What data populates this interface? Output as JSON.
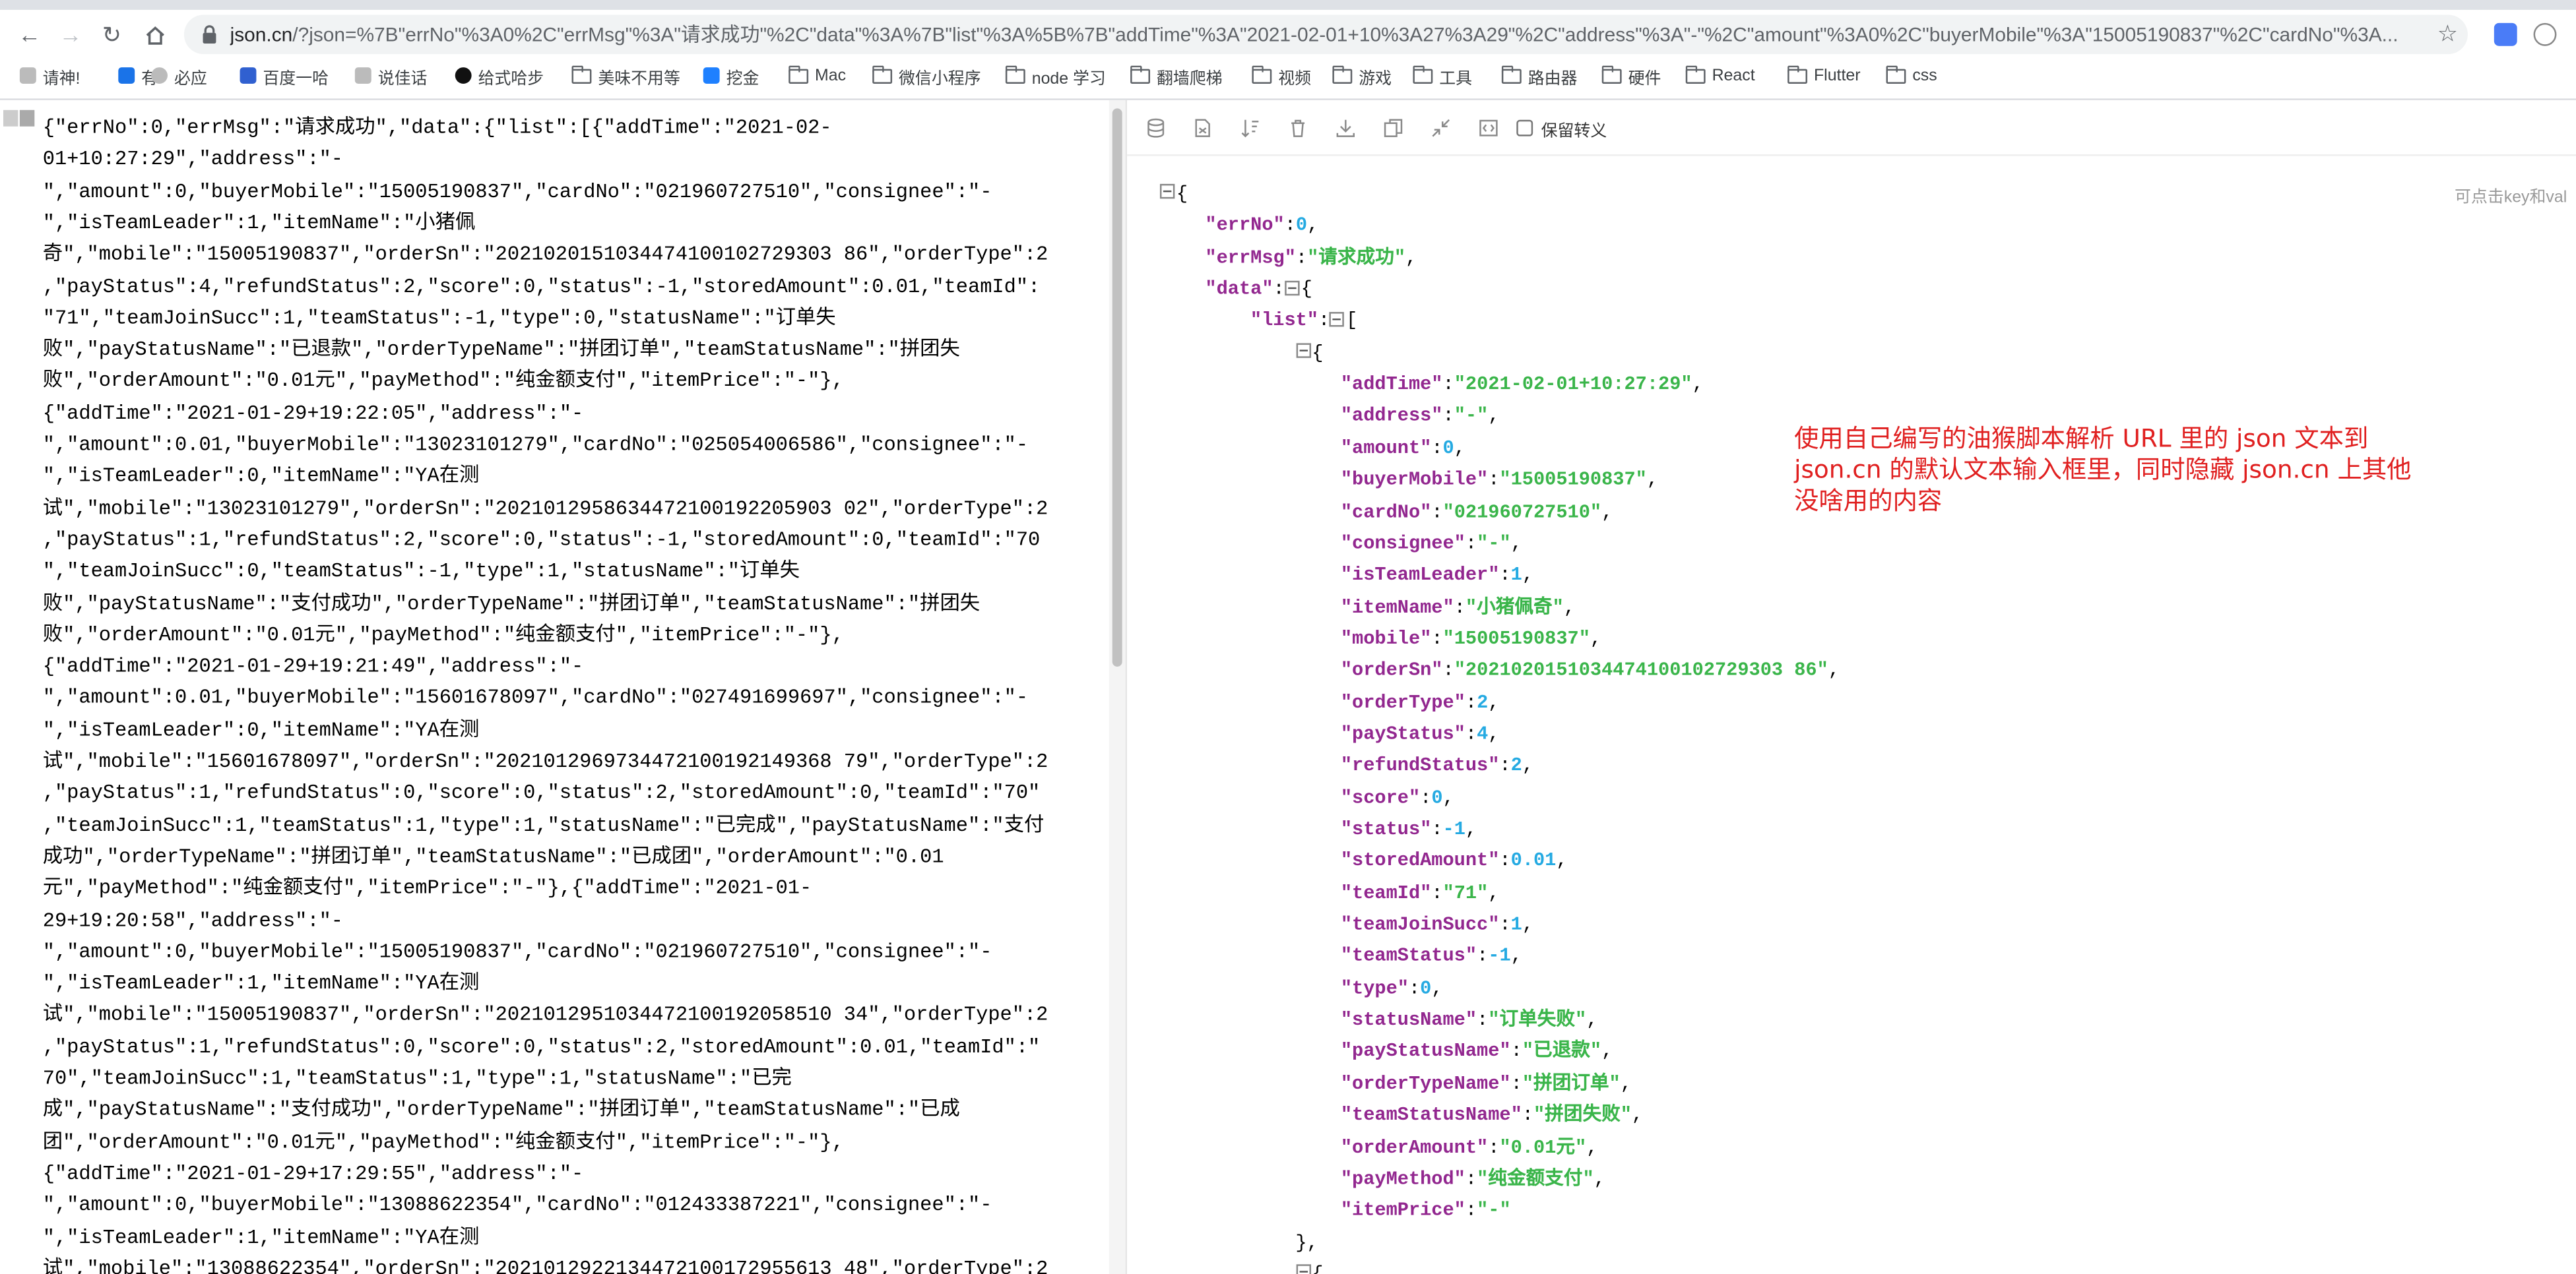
{
  "browser": {
    "url_host": "json.cn",
    "url_rest": "/?json=%7B\"errNo\"%3A0%2C\"errMsg\"%3A\"请求成功\"%2C\"data\"%3A%7B\"list\"%3A%5B%7B\"addTime\"%3A\"2021-02-01+10%3A27%3A29\"%2C\"address\"%3A\"-\"%2C\"amount\"%3A0%2C\"buyerMobile\"%3A\"15005190837\"%2C\"cardNo\"%3A..."
  },
  "bookmarks": [
    {
      "label": "请神!",
      "icon": "page-icon"
    },
    {
      "label": "有",
      "icon": "bing-icon"
    },
    {
      "label": "必应",
      "icon": "globe-icon"
    },
    {
      "label": "百度一哈",
      "icon": "paw-icon"
    },
    {
      "label": "说佳话",
      "icon": "page-icon"
    },
    {
      "label": "给式哈步",
      "icon": "github-icon"
    },
    {
      "label": "美味不用等",
      "icon": "folder-icon"
    },
    {
      "label": "挖金",
      "icon": "juejin-icon"
    },
    {
      "label": "Mac",
      "icon": "folder-icon"
    },
    {
      "label": "微信小程序",
      "icon": "folder-icon"
    },
    {
      "label": "node 学习",
      "icon": "folder-icon"
    },
    {
      "label": "翻墙爬梯",
      "icon": "folder-icon"
    },
    {
      "label": "视频",
      "icon": "folder-icon"
    },
    {
      "label": "游戏",
      "icon": "folder-icon"
    },
    {
      "label": "工具",
      "icon": "folder-icon"
    },
    {
      "label": "路由器",
      "icon": "folder-icon"
    },
    {
      "label": "硬件",
      "icon": "folder-icon"
    },
    {
      "label": "React",
      "icon": "folder-icon"
    },
    {
      "label": "Flutter",
      "icon": "folder-icon"
    },
    {
      "label": "css",
      "icon": "folder-icon"
    }
  ],
  "raw_text_lines": [
    "{\"errNo\":0,\"errMsg\":\"请求成功\",\"data\":{\"list\":[{\"addTime\":\"2021-02-",
    "01+10:27:29\",\"address\":\"-",
    "\",\"amount\":0,\"buyerMobile\":\"15005190837\",\"cardNo\":\"021960727510\",\"consignee\":\"-",
    "\",\"isTeamLeader\":1,\"itemName\":\"小猪佩",
    "奇\",\"mobile\":\"15005190837\",\"orderSn\":\"2021020151034474100102729303 86\",\"orderType\":2",
    ",\"payStatus\":4,\"refundStatus\":2,\"score\":0,\"status\":-1,\"storedAmount\":0.01,\"teamId\":",
    "\"71\",\"teamJoinSucc\":1,\"teamStatus\":-1,\"type\":0,\"statusName\":\"订单失",
    "败\",\"payStatusName\":\"已退款\",\"orderTypeName\":\"拼团订单\",\"teamStatusName\":\"拼团失",
    "败\",\"orderAmount\":\"0.01元\",\"payMethod\":\"纯金额支付\",\"itemPrice\":\"-\"},",
    "{\"addTime\":\"2021-01-29+19:22:05\",\"address\":\"-",
    "\",\"amount\":0.01,\"buyerMobile\":\"13023101279\",\"cardNo\":\"025054006586\",\"consignee\":\"-",
    "\",\"isTeamLeader\":0,\"itemName\":\"YA在测",
    "试\",\"mobile\":\"13023101279\",\"orderSn\":\"2021012958634472100192205903 02\",\"orderType\":2",
    ",\"payStatus\":1,\"refundStatus\":2,\"score\":0,\"status\":-1,\"storedAmount\":0,\"teamId\":\"70",
    "\",\"teamJoinSucc\":0,\"teamStatus\":-1,\"type\":1,\"statusName\":\"订单失",
    "败\",\"payStatusName\":\"支付成功\",\"orderTypeName\":\"拼团订单\",\"teamStatusName\":\"拼团失",
    "败\",\"orderAmount\":\"0.01元\",\"payMethod\":\"纯金额支付\",\"itemPrice\":\"-\"},",
    "{\"addTime\":\"2021-01-29+19:21:49\",\"address\":\"-",
    "\",\"amount\":0.01,\"buyerMobile\":\"15601678097\",\"cardNo\":\"027491699697\",\"consignee\":\"-",
    "\",\"isTeamLeader\":0,\"itemName\":\"YA在测",
    "试\",\"mobile\":\"15601678097\",\"orderSn\":\"2021012969734472100192149368 79\",\"orderType\":2",
    ",\"payStatus\":1,\"refundStatus\":0,\"score\":0,\"status\":2,\"storedAmount\":0,\"teamId\":\"70\"",
    ",\"teamJoinSucc\":1,\"teamStatus\":1,\"type\":1,\"statusName\":\"已完成\",\"payStatusName\":\"支付",
    "成功\",\"orderTypeName\":\"拼团订单\",\"teamStatusName\":\"已成团\",\"orderAmount\":\"0.01",
    "元\",\"payMethod\":\"纯金额支付\",\"itemPrice\":\"-\"},{\"addTime\":\"2021-01-",
    "29+19:20:58\",\"address\":\"-",
    "\",\"amount\":0,\"buyerMobile\":\"15005190837\",\"cardNo\":\"021960727510\",\"consignee\":\"-",
    "\",\"isTeamLeader\":1,\"itemName\":\"YA在测",
    "试\",\"mobile\":\"15005190837\",\"orderSn\":\"2021012951034472100192058510 34\",\"orderType\":2",
    ",\"payStatus\":1,\"refundStatus\":0,\"score\":0,\"status\":2,\"storedAmount\":0.01,\"teamId\":\"",
    "70\",\"teamJoinSucc\":1,\"teamStatus\":1,\"type\":1,\"statusName\":\"已完",
    "成\",\"payStatusName\":\"支付成功\",\"orderTypeName\":\"拼团订单\",\"teamStatusName\":\"已成",
    "团\",\"orderAmount\":\"0.01元\",\"payMethod\":\"纯金额支付\",\"itemPrice\":\"-\"},",
    "{\"addTime\":\"2021-01-29+17:29:55\",\"address\":\"-",
    "\",\"amount\":0,\"buyerMobile\":\"13088622354\",\"cardNo\":\"012433387221\",\"consignee\":\"-",
    "\",\"isTeamLeader\":1,\"itemName\":\"YA在测",
    "试\",\"mobile\":\"13088622354\",\"orderSn\":\"2021012922134472100172955613 48\",\"orderType\":2"
  ],
  "viewer": {
    "escape_label": "保留转义",
    "hint": "可点击key和val",
    "annotation": "使用自己编写的油猴脚本解析 URL 里的 json 文本到 json.cn 的默认文本输入框里，同时隐藏 json.cn 上其他没啥用的内容"
  },
  "tree": [
    {
      "indent": 0,
      "toggle": true,
      "parts": [
        [
          "p",
          "{"
        ]
      ]
    },
    {
      "indent": 1,
      "parts": [
        [
          "k",
          "\"errNo\""
        ],
        [
          "p",
          ":"
        ],
        [
          "n",
          "0"
        ],
        [
          "p",
          ","
        ]
      ]
    },
    {
      "indent": 1,
      "parts": [
        [
          "k",
          "\"errMsg\""
        ],
        [
          "p",
          ":"
        ],
        [
          "s",
          "\"请求成功\""
        ],
        [
          "p",
          ","
        ]
      ]
    },
    {
      "indent": 1,
      "parts": [
        [
          "k",
          "\"data\""
        ],
        [
          "p",
          ":"
        ],
        [
          "t",
          ""
        ],
        [
          "p",
          "{"
        ]
      ]
    },
    {
      "indent": 2,
      "parts": [
        [
          "k",
          "\"list\""
        ],
        [
          "p",
          ":"
        ],
        [
          "t",
          ""
        ],
        [
          "p",
          "["
        ]
      ]
    },
    {
      "indent": 3,
      "toggle": true,
      "parts": [
        [
          "p",
          "{"
        ]
      ]
    },
    {
      "indent": 4,
      "parts": [
        [
          "k",
          "\"addTime\""
        ],
        [
          "p",
          ":"
        ],
        [
          "s",
          "\"2021-02-01+10:27:29\""
        ],
        [
          "p",
          ","
        ]
      ]
    },
    {
      "indent": 4,
      "parts": [
        [
          "k",
          "\"address\""
        ],
        [
          "p",
          ":"
        ],
        [
          "s",
          "\"-\""
        ],
        [
          "p",
          ","
        ]
      ]
    },
    {
      "indent": 4,
      "parts": [
        [
          "k",
          "\"amount\""
        ],
        [
          "p",
          ":"
        ],
        [
          "n",
          "0"
        ],
        [
          "p",
          ","
        ]
      ]
    },
    {
      "indent": 4,
      "parts": [
        [
          "k",
          "\"buyerMobile\""
        ],
        [
          "p",
          ":"
        ],
        [
          "s",
          "\"15005190837\""
        ],
        [
          "p",
          ","
        ]
      ]
    },
    {
      "indent": 4,
      "parts": [
        [
          "k",
          "\"cardNo\""
        ],
        [
          "p",
          ":"
        ],
        [
          "s",
          "\"021960727510\""
        ],
        [
          "p",
          ","
        ]
      ]
    },
    {
      "indent": 4,
      "parts": [
        [
          "k",
          "\"consignee\""
        ],
        [
          "p",
          ":"
        ],
        [
          "s",
          "\"-\""
        ],
        [
          "p",
          ","
        ]
      ]
    },
    {
      "indent": 4,
      "parts": [
        [
          "k",
          "\"isTeamLeader\""
        ],
        [
          "p",
          ":"
        ],
        [
          "n",
          "1"
        ],
        [
          "p",
          ","
        ]
      ]
    },
    {
      "indent": 4,
      "parts": [
        [
          "k",
          "\"itemName\""
        ],
        [
          "p",
          ":"
        ],
        [
          "s",
          "\"小猪佩奇\""
        ],
        [
          "p",
          ","
        ]
      ]
    },
    {
      "indent": 4,
      "parts": [
        [
          "k",
          "\"mobile\""
        ],
        [
          "p",
          ":"
        ],
        [
          "s",
          "\"15005190837\""
        ],
        [
          "p",
          ","
        ]
      ]
    },
    {
      "indent": 4,
      "parts": [
        [
          "k",
          "\"orderSn\""
        ],
        [
          "p",
          ":"
        ],
        [
          "s",
          "\"2021020151034474100102729303 86\""
        ],
        [
          "p",
          ","
        ]
      ]
    },
    {
      "indent": 4,
      "parts": [
        [
          "k",
          "\"orderType\""
        ],
        [
          "p",
          ":"
        ],
        [
          "n",
          "2"
        ],
        [
          "p",
          ","
        ]
      ]
    },
    {
      "indent": 4,
      "parts": [
        [
          "k",
          "\"payStatus\""
        ],
        [
          "p",
          ":"
        ],
        [
          "n",
          "4"
        ],
        [
          "p",
          ","
        ]
      ]
    },
    {
      "indent": 4,
      "parts": [
        [
          "k",
          "\"refundStatus\""
        ],
        [
          "p",
          ":"
        ],
        [
          "n",
          "2"
        ],
        [
          "p",
          ","
        ]
      ]
    },
    {
      "indent": 4,
      "parts": [
        [
          "k",
          "\"score\""
        ],
        [
          "p",
          ":"
        ],
        [
          "n",
          "0"
        ],
        [
          "p",
          ","
        ]
      ]
    },
    {
      "indent": 4,
      "parts": [
        [
          "k",
          "\"status\""
        ],
        [
          "p",
          ":"
        ],
        [
          "n",
          "-1"
        ],
        [
          "p",
          ","
        ]
      ]
    },
    {
      "indent": 4,
      "parts": [
        [
          "k",
          "\"storedAmount\""
        ],
        [
          "p",
          ":"
        ],
        [
          "n",
          "0.01"
        ],
        [
          "p",
          ","
        ]
      ]
    },
    {
      "indent": 4,
      "parts": [
        [
          "k",
          "\"teamId\""
        ],
        [
          "p",
          ":"
        ],
        [
          "s",
          "\"71\""
        ],
        [
          "p",
          ","
        ]
      ]
    },
    {
      "indent": 4,
      "parts": [
        [
          "k",
          "\"teamJoinSucc\""
        ],
        [
          "p",
          ":"
        ],
        [
          "n",
          "1"
        ],
        [
          "p",
          ","
        ]
      ]
    },
    {
      "indent": 4,
      "parts": [
        [
          "k",
          "\"teamStatus\""
        ],
        [
          "p",
          ":"
        ],
        [
          "n",
          "-1"
        ],
        [
          "p",
          ","
        ]
      ]
    },
    {
      "indent": 4,
      "parts": [
        [
          "k",
          "\"type\""
        ],
        [
          "p",
          ":"
        ],
        [
          "n",
          "0"
        ],
        [
          "p",
          ","
        ]
      ]
    },
    {
      "indent": 4,
      "parts": [
        [
          "k",
          "\"statusName\""
        ],
        [
          "p",
          ":"
        ],
        [
          "s",
          "\"订单失败\""
        ],
        [
          "p",
          ","
        ]
      ]
    },
    {
      "indent": 4,
      "parts": [
        [
          "k",
          "\"payStatusName\""
        ],
        [
          "p",
          ":"
        ],
        [
          "s",
          "\"已退款\""
        ],
        [
          "p",
          ","
        ]
      ]
    },
    {
      "indent": 4,
      "parts": [
        [
          "k",
          "\"orderTypeName\""
        ],
        [
          "p",
          ":"
        ],
        [
          "s",
          "\"拼团订单\""
        ],
        [
          "p",
          ","
        ]
      ]
    },
    {
      "indent": 4,
      "parts": [
        [
          "k",
          "\"teamStatusName\""
        ],
        [
          "p",
          ":"
        ],
        [
          "s",
          "\"拼团失败\""
        ],
        [
          "p",
          ","
        ]
      ]
    },
    {
      "indent": 4,
      "parts": [
        [
          "k",
          "\"orderAmount\""
        ],
        [
          "p",
          ":"
        ],
        [
          "s",
          "\"0.01元\""
        ],
        [
          "p",
          ","
        ]
      ]
    },
    {
      "indent": 4,
      "parts": [
        [
          "k",
          "\"payMethod\""
        ],
        [
          "p",
          ":"
        ],
        [
          "s",
          "\"纯金额支付\""
        ],
        [
          "p",
          ","
        ]
      ]
    },
    {
      "indent": 4,
      "parts": [
        [
          "k",
          "\"itemPrice\""
        ],
        [
          "p",
          ":"
        ],
        [
          "s",
          "\"-\""
        ]
      ]
    },
    {
      "indent": 3,
      "parts": [
        [
          "p",
          "},"
        ]
      ]
    },
    {
      "indent": 3,
      "toggle": true,
      "parts": [
        [
          "p",
          "{"
        ]
      ]
    }
  ]
}
